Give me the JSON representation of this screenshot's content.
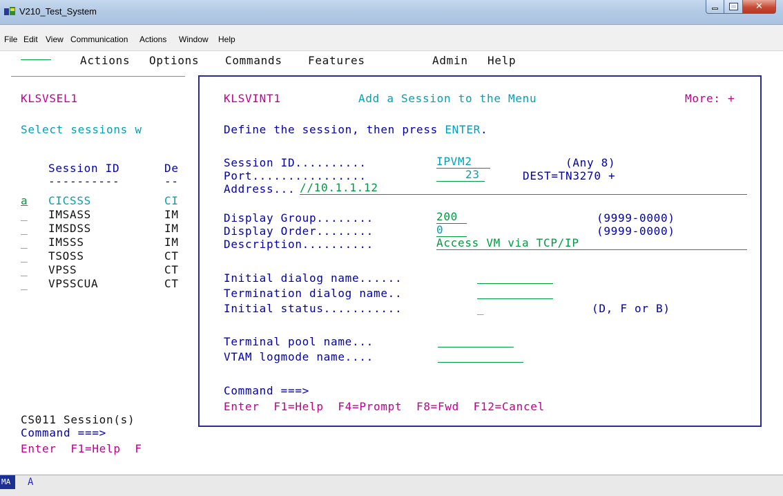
{
  "window": {
    "title": "V210_Test_System",
    "menu": [
      "File",
      "Edit",
      "View",
      "Communication",
      "Actions",
      "Window",
      "Help"
    ]
  },
  "terminal": {
    "action_bar": [
      "Actions",
      "Options",
      "Commands",
      "Features",
      "Admin",
      "Help"
    ],
    "left_panel": {
      "panel_id": "KLSVSEL1",
      "instructions": "Select sessions w",
      "col_session_id": "Session ID",
      "col_desc": "De",
      "col_session_id_dashes": "----------",
      "col_desc_dashes": "--",
      "rows": [
        {
          "sel": "a",
          "id": "CICSSS",
          "desc": "CI"
        },
        {
          "sel": "_",
          "id": "IMSASS",
          "desc": "IM"
        },
        {
          "sel": "_",
          "id": "IMSDSS",
          "desc": "IM"
        },
        {
          "sel": "_",
          "id": "IMSSS",
          "desc": "IM"
        },
        {
          "sel": "_",
          "id": "TSOSS",
          "desc": "CT"
        },
        {
          "sel": "_",
          "id": "VPSS",
          "desc": "CT"
        },
        {
          "sel": "_",
          "id": "VPSSCUA",
          "desc": "CT"
        }
      ],
      "message": "CS011 Session(s)",
      "command_label": "Command ===>",
      "fkeys": "Enter  F1=Help  F"
    },
    "popup": {
      "panel_id": "KLSVINT1",
      "title": "Add a Session to the Menu",
      "more": "More: +",
      "instruction_prefix": "Define the session, then press ",
      "instruction_key": "ENTER",
      "instruction_suffix": ".",
      "fields": {
        "session_id_label": "Session ID..........",
        "session_id_value": "IPVM2",
        "session_id_hint": "(Any 8)",
        "port_label": "Port................",
        "port_value": "23",
        "port_dest": "DEST=TN3270 +",
        "address_label": "Address...",
        "address_value": "//10.1.1.12",
        "display_group_label": "Display Group........",
        "display_group_value": "200",
        "display_group_hint": "(9999-0000)",
        "display_order_label": "Display Order........",
        "display_order_value": "0",
        "display_order_hint": "(9999-0000)",
        "description_label": "Description..........",
        "description_value": "Access VM via TCP/IP",
        "initial_dialog_label": "Initial dialog name......",
        "termination_dialog_label": "Termination dialog name..",
        "initial_status_label": "Initial status...........",
        "initial_status_value": "_",
        "initial_status_hint": "(D, F or B)",
        "terminal_pool_label": "Terminal pool name...",
        "vtam_logmode_label": "VTAM logmode name...."
      },
      "command_label": "Command ===>",
      "fkeys": "Enter  F1=Help  F4=Prompt  F8=Fwd  F12=Cancel"
    }
  },
  "statusbar": {
    "indicator": "MA",
    "indicator_box": "A",
    "status_char": "A"
  },
  "colors": {
    "pink": "#c0008f",
    "blue": "#0000b0",
    "teal": "#00a0b8",
    "green": "#009a3e",
    "popup_border": "#2a2a9a"
  },
  "icons": {
    "app": "terminal-emulator-icon",
    "minimize": "minimize-icon",
    "maximize": "maximize-icon",
    "close": "close-icon"
  }
}
